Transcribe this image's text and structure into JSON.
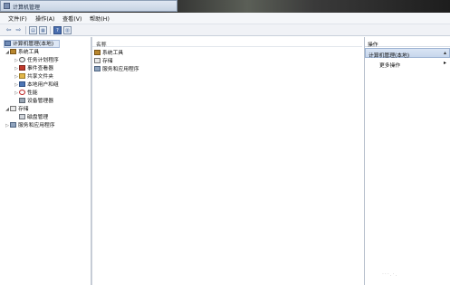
{
  "window": {
    "title": "计算机管理"
  },
  "menu": [
    "文件(F)",
    "操作(A)",
    "查看(V)",
    "帮助(H)"
  ],
  "toolbar": {
    "back_icon": "back-arrow-icon",
    "forward_icon": "forward-arrow-icon",
    "buttons": [
      "show-hide-tree-icon",
      "properties-icon",
      "help-icon",
      "show-action-pane-icon"
    ]
  },
  "tree": {
    "root": "计算机管理(本地)",
    "items": [
      {
        "label": "系统工具"
      },
      {
        "label": "任务计划程序"
      },
      {
        "label": "事件查看器"
      },
      {
        "label": "共享文件夹"
      },
      {
        "label": "本地用户和组"
      },
      {
        "label": "性能"
      },
      {
        "label": "设备管理器"
      },
      {
        "label": "存储"
      },
      {
        "label": "磁盘管理"
      },
      {
        "label": "服务和应用程序"
      }
    ]
  },
  "list": {
    "column_header": "名称",
    "items": [
      "系统工具",
      "存储",
      "服务和应用程序"
    ]
  },
  "actions": {
    "header": "操作",
    "section_title": "计算机管理(本地)",
    "more": "更多操作"
  }
}
